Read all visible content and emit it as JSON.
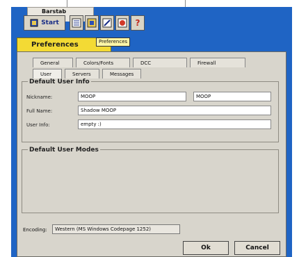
{
  "app": {
    "window_title": "Barstab",
    "tooltip": "Preferences",
    "toolbar": {
      "start_label": "Start",
      "icons": [
        "channel-list-icon",
        "dcc-icon",
        "settings-icon",
        "alert-icon",
        "help-icon"
      ],
      "help_glyph": "?"
    },
    "preferences_tab_label": "Preferences"
  },
  "preferences": {
    "tabs_row1": [
      "General",
      "Colors/Fonts",
      "DCC",
      "Firewall"
    ],
    "tabs_row2": [
      "User",
      "Servers",
      "Messages"
    ],
    "default_user_info": {
      "title": "Default User Info",
      "nickname_label": "Nickname:",
      "nickname_value": "MOOP",
      "nickname_alt_value": "MOOP",
      "fullname_label": "Full Name:",
      "fullname_value": "Shadow MOOP",
      "userinfo_label": "User Info:",
      "userinfo_value": "empty :)"
    },
    "default_user_modes": {
      "title": "Default User Modes"
    },
    "encoding": {
      "label": "Encoding:",
      "value": "Western (MS Windows Codepage 1252)"
    },
    "ok_label": "Ok",
    "cancel_label": "Cancel"
  },
  "colors": {
    "app_bg": "#1f64c4",
    "prefs_tab": "#f3da34",
    "panel": "#d8d5cc"
  }
}
